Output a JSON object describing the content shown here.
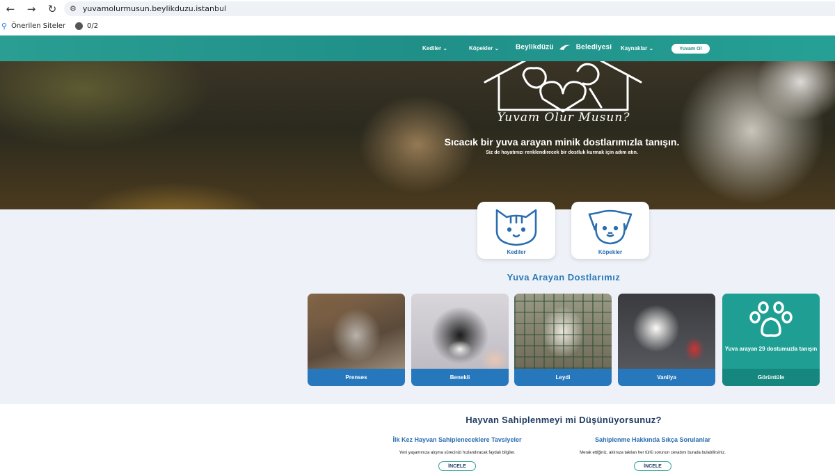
{
  "browser": {
    "back_icon": "arrow-left-icon",
    "forward_icon": "arrow-right-icon",
    "reload_icon": "reload-icon",
    "url": "yuvamolurmusun.beylikduzu.istanbul",
    "bookmarks": [
      {
        "label": "Önerilen Siteler",
        "icon": "search-icon"
      },
      {
        "label": "0/2",
        "icon": "globe-icon"
      }
    ]
  },
  "nav": {
    "items": [
      {
        "label": "Kediler"
      },
      {
        "label": "Köpekler"
      },
      {
        "label": "Kaynaklar"
      }
    ],
    "logo_left": "Beylikdüzü",
    "logo_right": "Belediyesi",
    "cta": "Yuvam Ol",
    "accent": "#1f8f88"
  },
  "hero": {
    "script": "Yuvam Olur Musun?",
    "title": "Sıcacık bir yuva arayan minik dostlarımızla tanışın.",
    "subtitle": "Siz de hayatınızı renklendirecek bir dostluk kurmak için adım atın."
  },
  "categories": [
    {
      "label": "Kediler",
      "icon": "cat-icon"
    },
    {
      "label": "Köpekler",
      "icon": "dog-icon"
    }
  ],
  "pets_section": {
    "title": "Yuva Arayan Dostlarımız",
    "pets": [
      {
        "name": "Prenses"
      },
      {
        "name": "Benekli"
      },
      {
        "name": "Leydi"
      },
      {
        "name": "Vanilya"
      }
    ],
    "see_all_text": "Yuva arayan 29 dostumuzla tanışın",
    "see_all_button": "Görüntüle"
  },
  "adoption": {
    "title": "Hayvan Sahiplenmeyi mi Düşünüyorsunuz?",
    "columns": [
      {
        "title": "İlk Kez Hayvan Sahipleneceklere Tavsiyeler",
        "text": "Yeni yaşamınıza alışma sürecinizi hızlandıracak faydalı bilgiler.",
        "button": "İNCELE"
      },
      {
        "title": "Sahiplenme Hakkında Sıkça Sorulanlar",
        "text": "Merak ettiğiniz, aklınıza takılan her türlü sorunun cevabını burada bulabilirsiniz.",
        "button": "İNCELE"
      }
    ]
  }
}
